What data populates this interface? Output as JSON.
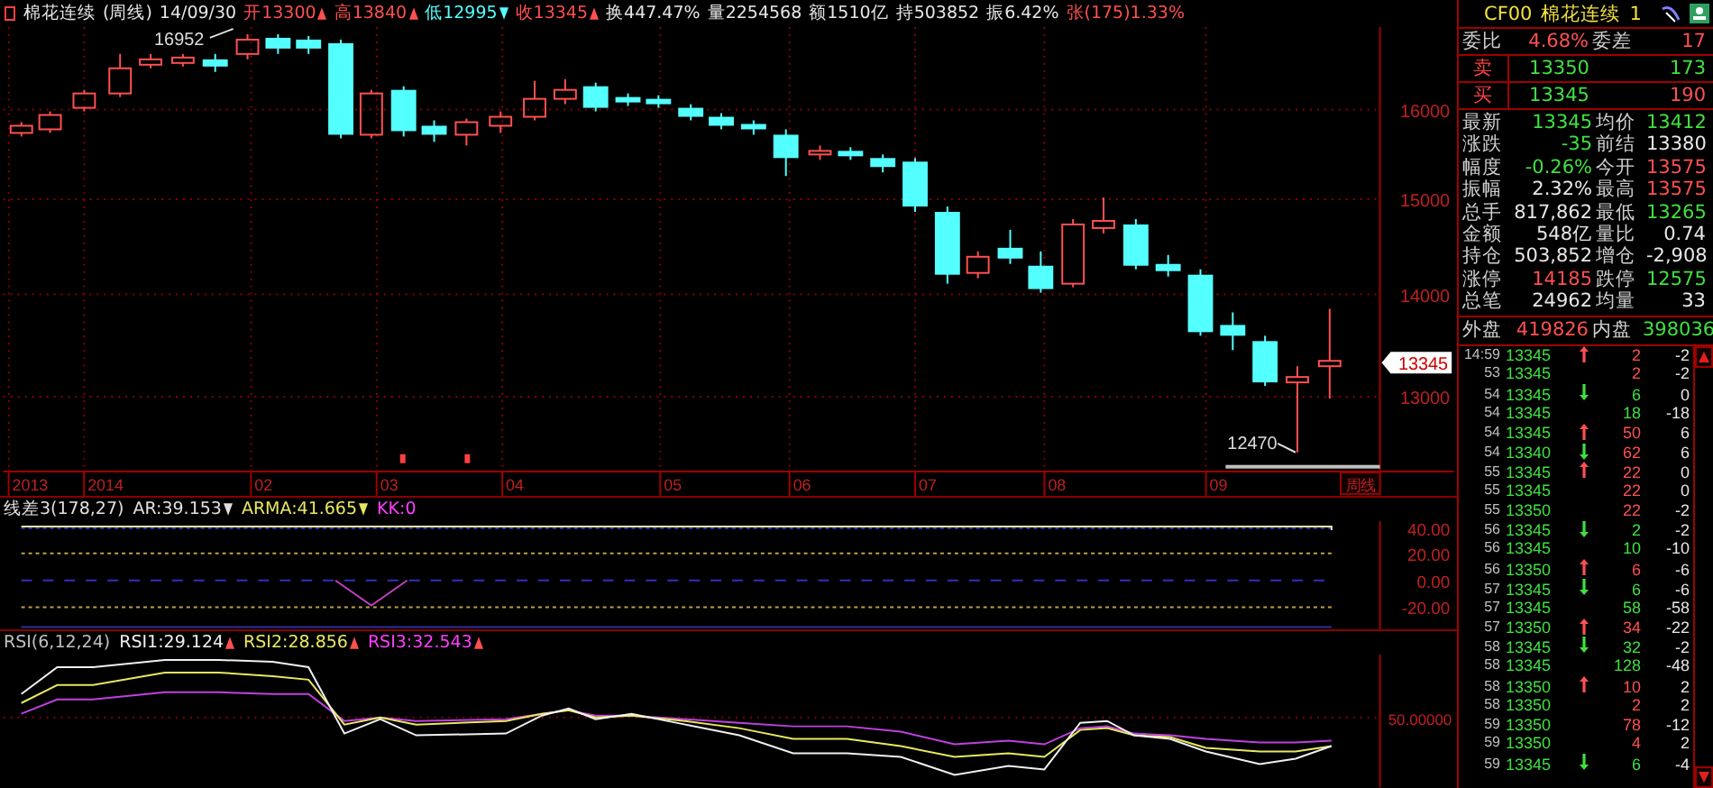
{
  "header": {
    "symbol": "棉花连续",
    "period": "(周线)",
    "date": "14/09/30",
    "fields": [
      {
        "text": "开13300",
        "color": "#ff5050",
        "kind": "rising"
      },
      {
        "text": "高13840",
        "color": "#ff5050",
        "kind": "rising"
      },
      {
        "text": "低12995",
        "color": "#54ffff",
        "kind": "falling"
      },
      {
        "text": "收13345",
        "color": "#ff5050",
        "kind": "rising"
      },
      {
        "text": "换447.47%",
        "color": "#e6e6e6",
        "kind": "plain"
      },
      {
        "text": "量2254568",
        "color": "#e6e6e6",
        "kind": "plain"
      },
      {
        "text": "额1510亿",
        "color": "#e6e6e6",
        "kind": "plain"
      },
      {
        "text": "持503852",
        "color": "#e6e6e6",
        "kind": "plain"
      },
      {
        "text": "振6.42%",
        "color": "#e6e6e6",
        "kind": "plain"
      },
      {
        "text": "张(175)1.33%",
        "color": "#ff5050",
        "kind": "plain"
      }
    ]
  },
  "price_chart": {
    "high_label": "16952",
    "low_label": "12470",
    "current_price": "13345",
    "y_labels": [
      "16000",
      "15000",
      "14000",
      "13000"
    ],
    "x_labels": [
      "2013",
      "2014",
      "02",
      "03",
      "04",
      "05",
      "06",
      "07",
      "08",
      "09"
    ],
    "period_button": "周线"
  },
  "indicator": {
    "legend": [
      {
        "text": "线差3(178,27)",
        "color": "#e0e0e0",
        "kind": "plain"
      },
      {
        "text": "AR:39.153",
        "color": "#e0e0e0",
        "kind": "falling"
      },
      {
        "text": "ARMA:41.665",
        "color": "#e8e860",
        "kind": "falling"
      },
      {
        "text": "KK:0",
        "color": "#ff40ff",
        "kind": "plain"
      }
    ],
    "y_labels": [
      "40.00",
      "20.00",
      "0.00",
      "-20.00"
    ]
  },
  "rsi": {
    "legend": [
      {
        "text": "RSI(6,12,24)",
        "color": "#c0c0c0",
        "kind": "plain"
      },
      {
        "text": "RSI1:29.124",
        "color": "#f0f0f0",
        "kind": "rising"
      },
      {
        "text": "RSI2:28.856",
        "color": "#e8e860",
        "kind": "rising"
      },
      {
        "text": "RSI3:32.543",
        "color": "#ff40ff",
        "kind": "rising"
      }
    ],
    "y_label": "50.00000"
  },
  "quote_panel": {
    "code": "CF00",
    "name": "棉花连续",
    "number": "1",
    "order_ratio": [
      {
        "label": "委比",
        "value": "4.68%",
        "color": "#ff5050"
      },
      {
        "label": "委差",
        "value": "17",
        "color": "#ff5050"
      }
    ],
    "book": [
      {
        "label": "卖",
        "price": {
          "value": "13350",
          "color": "#40e040"
        },
        "volume": {
          "value": "173",
          "color": "#40e040"
        }
      },
      {
        "label": "买",
        "price": {
          "value": "13345",
          "color": "#40e040"
        },
        "volume": {
          "value": "190",
          "color": "#ff5050"
        }
      }
    ],
    "stats": [
      [
        {
          "label": "最新",
          "value": "13345",
          "color": "#40e040"
        },
        {
          "label": "均价",
          "value": "13412",
          "color": "#40e040"
        }
      ],
      [
        {
          "label": "涨跌",
          "value": "-35",
          "color": "#40e040"
        },
        {
          "label": "前结",
          "value": "13380",
          "color": "#e6e6e6"
        }
      ],
      [
        {
          "label": "幅度",
          "value": "-0.26%",
          "color": "#40e040"
        },
        {
          "label": "今开",
          "value": "13575",
          "color": "#ff5050"
        }
      ],
      [
        {
          "label": "振幅",
          "value": "2.32%",
          "color": "#e6e6e6"
        },
        {
          "label": "最高",
          "value": "13575",
          "color": "#ff5050"
        }
      ],
      [
        {
          "label": "总手",
          "value": "817,862",
          "color": "#e6e6e6"
        },
        {
          "label": "最低",
          "value": "13265",
          "color": "#40e040"
        }
      ],
      [
        {
          "label": "金额",
          "value": "548亿",
          "color": "#e6e6e6"
        },
        {
          "label": "量比",
          "value": "0.74",
          "color": "#e6e6e6"
        }
      ],
      [
        {
          "label": "持仓",
          "value": "503,852",
          "color": "#e6e6e6"
        },
        {
          "label": "增仓",
          "value": "-2,908",
          "color": "#e6e6e6"
        }
      ],
      [
        {
          "label": "涨停",
          "value": "14185",
          "color": "#ff5050"
        },
        {
          "label": "跌停",
          "value": "12575",
          "color": "#40e040"
        }
      ],
      [
        {
          "label": "总笔",
          "value": "24962",
          "color": "#e6e6e6"
        },
        {
          "label": "均量",
          "value": "33",
          "color": "#e6e6e6"
        }
      ]
    ],
    "outer_inner": [
      {
        "label": "外盘",
        "value": "419826",
        "color": "#ff5050"
      },
      {
        "label": "内盘",
        "value": "398036",
        "color": "#40e040"
      }
    ],
    "ticks": [
      {
        "time": "14:59",
        "price": "13345",
        "kind": "rising",
        "volume": "2",
        "color": "#ff5050",
        "change": "-2"
      },
      {
        "time": "53",
        "price": "13345",
        "kind": "plain",
        "volume": "2",
        "color": "#ff5050",
        "change": "-2"
      },
      {
        "time": "54",
        "price": "13345",
        "kind": "falling",
        "volume": "6",
        "color": "#40e040",
        "change": "0"
      },
      {
        "time": "54",
        "price": "13345",
        "kind": "plain",
        "volume": "18",
        "color": "#40e040",
        "change": "-18"
      },
      {
        "time": "54",
        "price": "13345",
        "kind": "rising",
        "volume": "50",
        "color": "#ff5050",
        "change": "6"
      },
      {
        "time": "54",
        "price": "13340",
        "kind": "falling",
        "volume": "62",
        "color": "#ff5050",
        "change": "6"
      },
      {
        "time": "55",
        "price": "13345",
        "kind": "rising",
        "volume": "22",
        "color": "#ff5050",
        "change": "0"
      },
      {
        "time": "55",
        "price": "13345",
        "kind": "plain",
        "volume": "22",
        "color": "#ff5050",
        "change": "0"
      },
      {
        "time": "55",
        "price": "13350",
        "kind": "plain",
        "volume": "22",
        "color": "#ff5050",
        "change": "-2"
      },
      {
        "time": "56",
        "price": "13345",
        "kind": "falling",
        "volume": "2",
        "color": "#40e040",
        "change": "-2"
      },
      {
        "time": "56",
        "price": "13345",
        "kind": "plain",
        "volume": "10",
        "color": "#40e040",
        "change": "-10"
      },
      {
        "time": "56",
        "price": "13350",
        "kind": "rising",
        "volume": "6",
        "color": "#ff5050",
        "change": "-6"
      },
      {
        "time": "57",
        "price": "13345",
        "kind": "falling",
        "volume": "6",
        "color": "#40e040",
        "change": "-6"
      },
      {
        "time": "57",
        "price": "13345",
        "kind": "plain",
        "volume": "58",
        "color": "#40e040",
        "change": "-58"
      },
      {
        "time": "57",
        "price": "13350",
        "kind": "rising",
        "volume": "34",
        "color": "#ff5050",
        "change": "-22"
      },
      {
        "time": "58",
        "price": "13345",
        "kind": "falling",
        "volume": "32",
        "color": "#40e040",
        "change": "-2"
      },
      {
        "time": "58",
        "price": "13345",
        "kind": "plain",
        "volume": "128",
        "color": "#40e040",
        "change": "-48"
      },
      {
        "time": "58",
        "price": "13350",
        "kind": "rising",
        "volume": "10",
        "color": "#ff5050",
        "change": "2"
      },
      {
        "time": "58",
        "price": "13350",
        "kind": "plain",
        "volume": "2",
        "color": "#ff5050",
        "change": "2"
      },
      {
        "time": "59",
        "price": "13350",
        "kind": "plain",
        "volume": "78",
        "color": "#ff5050",
        "change": "-12"
      },
      {
        "time": "59",
        "price": "13350",
        "kind": "plain",
        "volume": "4",
        "color": "#ff5050",
        "change": "2"
      },
      {
        "time": "59",
        "price": "13345",
        "kind": "falling",
        "volume": "6",
        "color": "#40e040",
        "change": "-4"
      }
    ]
  }
}
